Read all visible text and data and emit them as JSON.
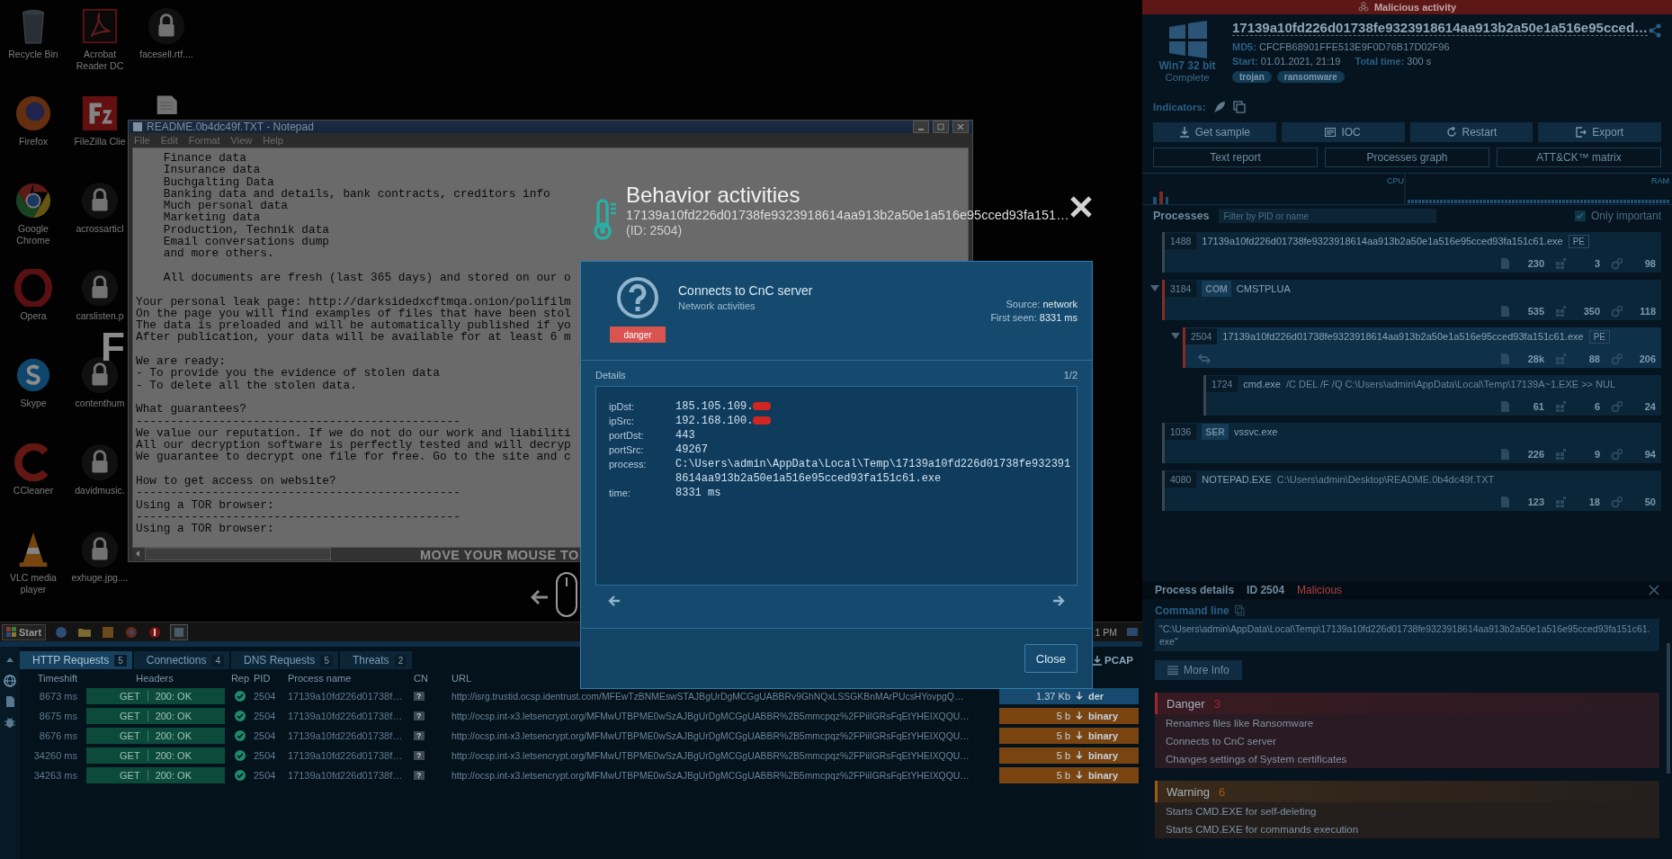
{
  "desktop": {
    "icons": [
      {
        "kind": "trash",
        "label": "Recycle Bin"
      },
      {
        "kind": "firefox",
        "label": "Firefox"
      },
      {
        "kind": "chrome",
        "label": "Google Chrome"
      },
      {
        "kind": "opera",
        "label": "Opera"
      },
      {
        "kind": "skype",
        "label": "Skype"
      },
      {
        "kind": "ccleaner",
        "label": "CCleaner"
      },
      {
        "kind": "vlc",
        "label": "VLC media player"
      },
      {
        "kind": "pdf",
        "label": "Acrobat Reader DC"
      },
      {
        "kind": "filezilla",
        "label": "FileZilla Clie"
      },
      {
        "kind": "locked",
        "label": "acrossarticl"
      },
      {
        "kind": "locked",
        "label": "carslisten.p"
      },
      {
        "kind": "locked",
        "label": "contenthum"
      },
      {
        "kind": "locked",
        "label": "davidmusic."
      },
      {
        "kind": "locked",
        "label": "exhuge.jpg...."
      },
      {
        "kind": "locked",
        "label": "facesell.rtf...."
      },
      {
        "kind": "document"
      }
    ],
    "wallpaper_letter": "F",
    "hint": "MOVE YOUR MOUSE TO"
  },
  "notepad": {
    "title": "README.0b4dc49f.TXT - Notepad",
    "menu": [
      "File",
      "Edit",
      "Format",
      "View",
      "Help"
    ],
    "blocks": [
      [
        "    Finance data",
        "    Insurance data",
        "    Buchgalting Data",
        "    Banking data and details, bank contracts, creditors info",
        "    Much personal data",
        "    Marketing data",
        "    Production, Technik data",
        "    Email conversations dump",
        "    and more others."
      ],
      [
        "    All documents are fresh (last 365 days) and stored on our o"
      ],
      [
        "Your personal leak page: http://darksidedxcftmqa.onion/polifilm",
        "On the page you will find examples of files that have been stol",
        "The data is preloaded and will be automatically published if yo",
        "After publication, your data will be available for at least 6 m"
      ],
      [
        "We are ready:",
        "- To provide you the evidence of stolen data",
        "- To delete all the stolen data."
      ],
      [
        "What guarantees?",
        "-----------------------------------------------",
        "We value our reputation. If we do not do our work and liabiliti",
        "All our decryption software is perfectly tested and will decryp",
        "We guarantee to decrypt one file for free. Go to the site and c"
      ],
      [
        "How to get access on website?",
        "-----------------------------------------------",
        "Using a TOR browser:",
        "-----------------------------------------------",
        "Using a TOR browser:"
      ]
    ]
  },
  "taskbar": {
    "start": "Start",
    "clock": "1 PM"
  },
  "traffic": {
    "tabs": [
      {
        "label": "HTTP Requests",
        "count": "5",
        "selected": true
      },
      {
        "label": "Connections",
        "count": "4",
        "selected": false
      },
      {
        "label": "DNS Requests",
        "count": "5",
        "selected": false
      },
      {
        "label": "Threats",
        "count": "2",
        "selected": false
      }
    ],
    "pcap": "PCAP",
    "columns": [
      "Timeshift",
      "Headers",
      "Rep",
      "PID",
      "Process name",
      "CN",
      "URL"
    ],
    "rows": [
      {
        "timeshift": "8673 ms",
        "method": "GET",
        "status": "200: OK",
        "rep_ok": true,
        "pid": "2504",
        "process": "17139a10fd226d01738f…",
        "cn": "?",
        "url": "http://isrg.trustid.ocsp.identrust.com/MFEwTzBNMEswSTAJBgUrDgMCGgUABBRv9GhNQxLSSGKBnMArPUcsHYovpgQ…",
        "size": "1.37 Kb",
        "type": "der",
        "color": "#174a6e"
      },
      {
        "timeshift": "8675 ms",
        "method": "GET",
        "status": "200: OK",
        "rep_ok": true,
        "pid": "2504",
        "process": "17139a10fd226d01738f…",
        "cn": "?",
        "url": "http://ocsp.int-x3.letsencrypt.org/MFMwUTBPME0wSzAJBgUrDgMCGgUABBR%2B5mmcpqz%2FPiiIGRsFqEtYHEIXQQU…",
        "size": "5 b",
        "type": "binary",
        "color": "#7a4410"
      },
      {
        "timeshift": "8676 ms",
        "method": "GET",
        "status": "200: OK",
        "rep_ok": true,
        "pid": "2504",
        "process": "17139a10fd226d01738f…",
        "cn": "?",
        "url": "http://ocsp.int-x3.letsencrypt.org/MFMwUTBPME0wSzAJBgUrDgMCGgUABBR%2B5mmcpqz%2FPiiIGRsFqEtYHEIXQQU…",
        "size": "5 b",
        "type": "binary",
        "color": "#7a4410"
      },
      {
        "timeshift": "34260 ms",
        "method": "GET",
        "status": "200: OK",
        "rep_ok": true,
        "pid": "2504",
        "process": "17139a10fd226d01738f…",
        "cn": "?",
        "url": "http://ocsp.int-x3.letsencrypt.org/MFMwUTBPME0wSzAJBgUrDgMCGgUABBR%2B5mmcpqz%2FPiiIGRsFqEtYHEIXQQU…",
        "size": "5 b",
        "type": "binary",
        "color": "#7a4410"
      },
      {
        "timeshift": "34263 ms",
        "method": "GET",
        "status": "200: OK",
        "rep_ok": true,
        "pid": "2504",
        "process": "17139a10fd226d01738f…",
        "cn": "?",
        "url": "http://ocsp.int-x3.letsencrypt.org/MFMwUTBPME0wSzAJBgUrDgMCGgUABBR%2B5mmcpqz%2FPiiIGRsFqEtYHEIXQQU…",
        "size": "5 b",
        "type": "binary",
        "color": "#7a4410"
      }
    ]
  },
  "report": {
    "banner": "Malicious activity",
    "os": "Win7 32 bit",
    "status": "Complete",
    "title": "17139a10fd226d01738fe9323918614aa913b2a50e1a516e95cced…",
    "md5_label": "MD5:",
    "md5": "CFCFB68901FFE513E9F0D76B17D02F96",
    "start_label": "Start:",
    "start": "01.01.2021, 21:19",
    "total_label": "Total time:",
    "total": "300 s",
    "tags": [
      "trojan",
      "ransomware"
    ],
    "indicators_label": "Indicators:",
    "actions": [
      {
        "label": "Get sample",
        "kind": "download"
      },
      {
        "label": "IOC",
        "kind": "list"
      },
      {
        "label": "Restart",
        "kind": "restart"
      },
      {
        "label": "Export",
        "kind": "export"
      }
    ],
    "views": [
      "Text report",
      "Processes graph",
      "ATT&CK™ matrix"
    ],
    "monitor": {
      "cpu": "CPU",
      "ram": "RAM"
    },
    "processes": {
      "title": "Processes",
      "filter_placeholder": "Filter by PID or name",
      "only_important": {
        "label": "Only important",
        "checked": true
      },
      "items": [
        {
          "pid": "1488",
          "name": "17139a10fd226d01738fe9323918614aa913b2a50e1a516e95cced93fa151c61.exe",
          "pe": "PE",
          "connections": false,
          "files": "230",
          "registry": "3",
          "network": "98",
          "malicious": false,
          "selected": false,
          "expanded": false
        },
        {
          "pid": "3184",
          "tag": "COM",
          "name": "CMSTPLUA",
          "connections": false,
          "files": "535",
          "registry": "350",
          "network": "118",
          "malicious": true,
          "selected": false,
          "expanded": true,
          "children": [
            {
              "pid": "2504",
              "name": "17139a10fd226d01738fe9323918614aa913b2a50e1a516e95cced93fa151c61.exe",
              "pe": "PE",
              "connections": true,
              "files": "28k",
              "registry": "88",
              "network": "206",
              "malicious": true,
              "selected": true,
              "expanded": true,
              "children": [
                {
                  "pid": "1724",
                  "name": "cmd.exe",
                  "args": "/C DEL /F /Q C:\\Users\\admin\\AppData\\Local\\Temp\\17139A~1.EXE >> NUL",
                  "connections": false,
                  "files": "61",
                  "registry": "6",
                  "network": "24",
                  "malicious": false,
                  "selected": false,
                  "expanded": false
                }
              ]
            }
          ]
        },
        {
          "pid": "1036",
          "tag": "SER",
          "name": "vssvc.exe",
          "connections": false,
          "files": "226",
          "registry": "9",
          "network": "94",
          "malicious": false,
          "selected": false,
          "expanded": false
        },
        {
          "pid": "4080",
          "name": "NOTEPAD.EXE",
          "args": "C:\\Users\\admin\\Desktop\\README.0b4dc49f.TXT",
          "connections": false,
          "files": "123",
          "registry": "18",
          "network": "50",
          "malicious": false,
          "selected": false,
          "expanded": false
        }
      ]
    },
    "details": {
      "title": "Process details",
      "id": "ID 2504",
      "verdict": "Malicious",
      "command_label": "Command line",
      "command": "\"C:\\Users\\admin\\AppData\\Local\\Temp\\17139a10fd226d01738fe9323918614aa913b2a50e1a516e95cced93fa151c61.exe\"",
      "more": "More Info",
      "groups": [
        {
          "kind": "danger",
          "title": "Danger",
          "count": "3",
          "items": [
            "Renames files like Ransomware",
            "Connects to CnC server",
            "Changes settings of System certificates"
          ]
        },
        {
          "kind": "warning",
          "title": "Warning",
          "count": "6",
          "items": [
            "Starts CMD.EXE for self-deleting",
            "Starts CMD.EXE for commands execution"
          ]
        }
      ]
    }
  },
  "modal": {
    "title": "Behavior activities",
    "subject": "17139a10fd226d01738fe9323918614aa913b2a50e1a516e95cced93fa151…",
    "pid": "(ID: 2504)",
    "card": {
      "title": "Connects to CnC server",
      "category": "Network activities",
      "severity": "danger",
      "source_label": "Source:",
      "source": "network",
      "first_seen_label": "First seen:",
      "first_seen": "8331 ms",
      "details_label": "Details",
      "page": "1/2",
      "fields": [
        {
          "key": "ipDst:",
          "value": "185.105.109.",
          "redacted": true
        },
        {
          "key": "ipSrc:",
          "value": "192.168.100.",
          "redacted": true
        },
        {
          "key": "portDst:",
          "value": "443",
          "redacted": false
        },
        {
          "key": "portSrc:",
          "value": "49267",
          "redacted": false
        },
        {
          "key": "process:",
          "value": "C:\\Users\\admin\\AppData\\Local\\Temp\\17139a10fd226d01738fe9323918614aa913b2a50e1a516e95cced93fa151c61.exe",
          "redacted": false
        },
        {
          "key": "time:",
          "value": "8331 ms",
          "redacted": false
        }
      ],
      "close": "Close"
    }
  }
}
